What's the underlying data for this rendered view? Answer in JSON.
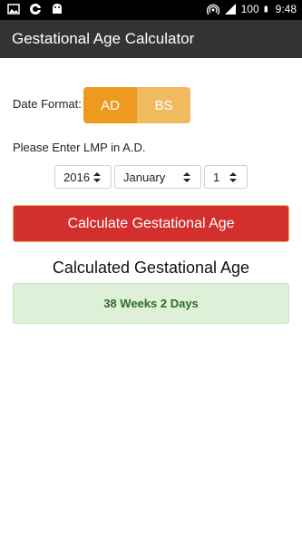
{
  "status_bar": {
    "battery": "100",
    "time": "9:48",
    "icons": [
      "image-icon",
      "vpn-shield-icon",
      "android-icon",
      "hotspot-icon",
      "signal-icon",
      "battery-icon"
    ]
  },
  "app_bar": {
    "title": "Gestational Age Calculator",
    "background": "#333333"
  },
  "date_format": {
    "label": "Date Format:",
    "options": [
      {
        "label": "AD",
        "selected": true,
        "color": "#ee9a1e"
      },
      {
        "label": "BS",
        "selected": false,
        "color": "#f1ba61"
      }
    ]
  },
  "lmp": {
    "label": "Please Enter LMP in A.D.",
    "year": "2016",
    "month": "January",
    "day": "1"
  },
  "calculate_button": {
    "label": "Calculate Gestational Age",
    "color": "#d32f2f"
  },
  "result": {
    "title": "Calculated Gestational Age",
    "value": "38 Weeks 2 Days",
    "background": "#dff0d8",
    "text_color": "#2e6d28"
  }
}
